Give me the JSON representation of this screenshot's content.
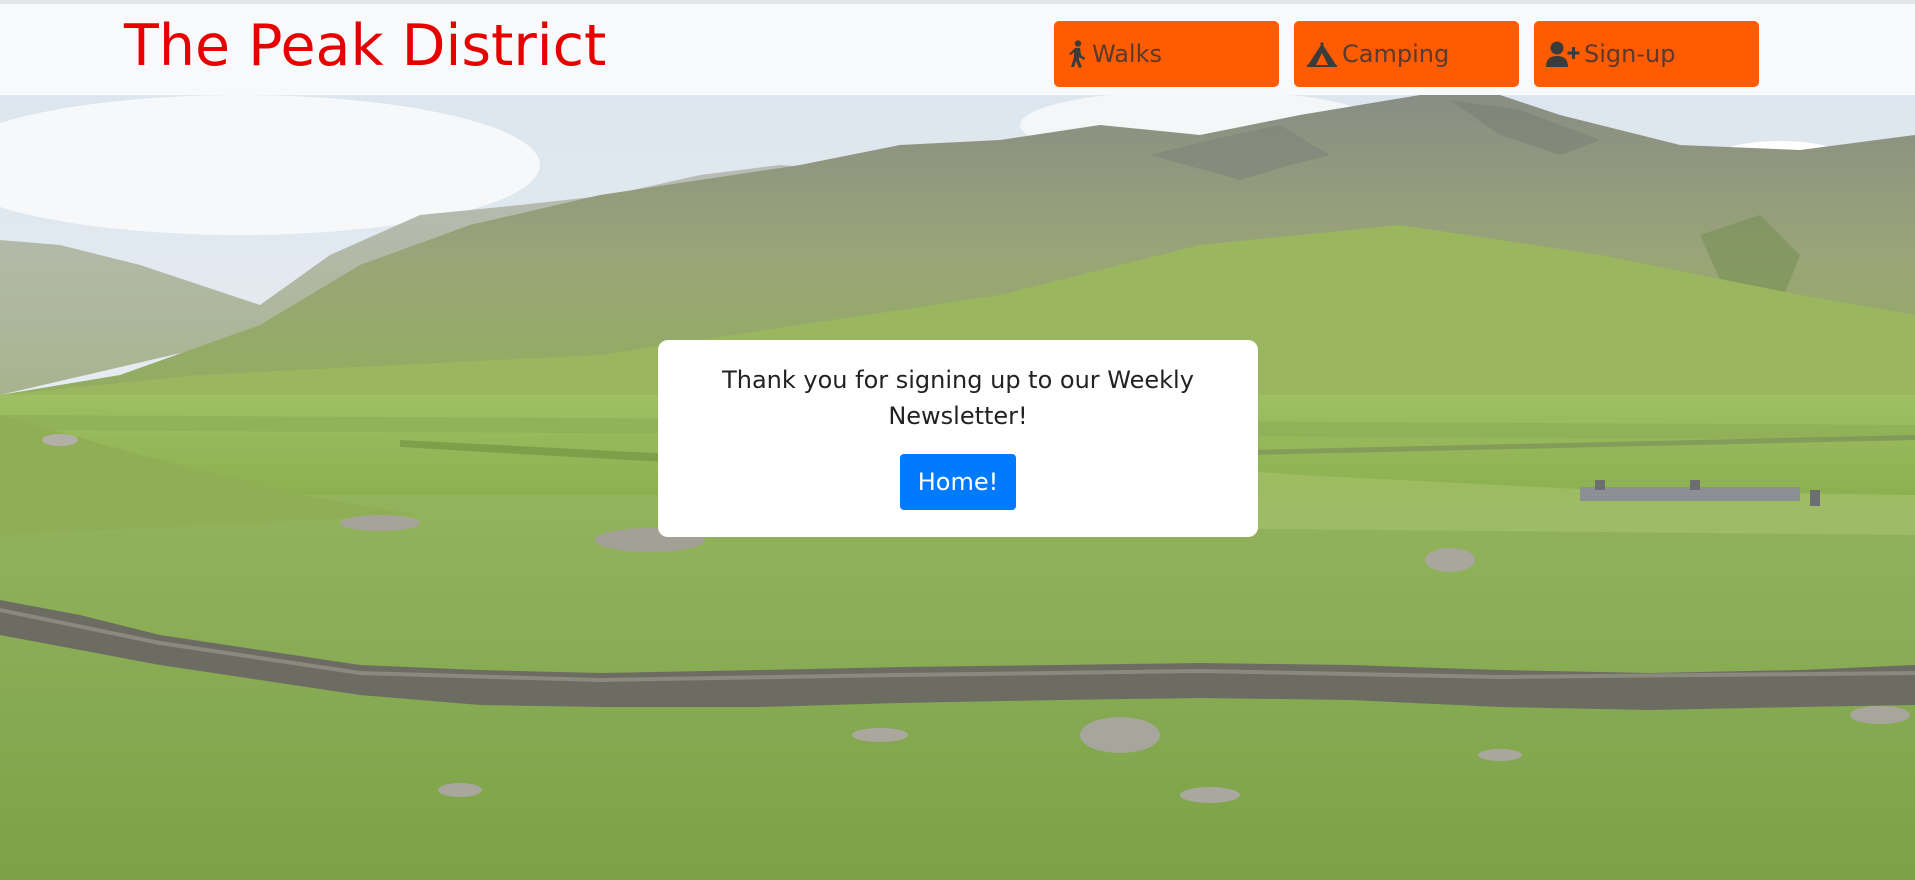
{
  "header": {
    "brand": "The Peak District",
    "nav": {
      "walks": "Walks",
      "camping": "Camping",
      "signup": "Sign-up"
    }
  },
  "confirmation": {
    "message": "Thank you for signing up to our Weekly Newsletter!",
    "home_button": "Home!"
  },
  "colors": {
    "brand": "#e60000",
    "nav_button": "#ff5b00",
    "home_button": "#007bff"
  },
  "icons": {
    "walks": "person-walking-icon",
    "camping": "tent-icon",
    "signup": "user-plus-icon"
  }
}
